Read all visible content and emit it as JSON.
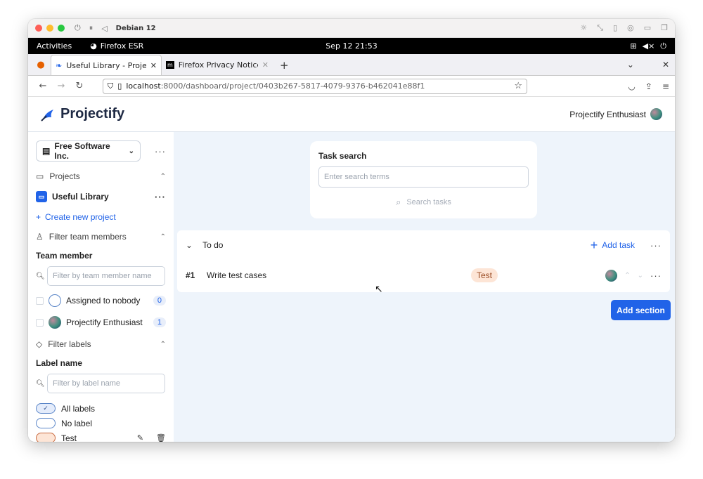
{
  "vm": {
    "title": "Debian 12"
  },
  "gnome": {
    "activities": "Activities",
    "app": "Firefox ESR",
    "clock": "Sep 12  21:53"
  },
  "tabs": [
    {
      "label": "Useful Library - Projectify"
    },
    {
      "label": "Firefox Privacy Notice — "
    }
  ],
  "url": {
    "host": "localhost",
    "path": ":8000/dashboard/project/0403b267-5817-4079-9376-b462041e88f1"
  },
  "app": {
    "name": "Projectify",
    "user": "Projectify Enthusiast"
  },
  "sidebar": {
    "org": "Free Software Inc.",
    "projects_heading": "Projects",
    "project": "Useful Library",
    "create_project": "Create new project",
    "filter_members_heading": "Filter team members",
    "team_member_label": "Team member",
    "member_filter_placeholder": "Filter by team member name",
    "members": [
      {
        "name": "Assigned to nobody",
        "count": "0"
      },
      {
        "name": "Projectify Enthusiast",
        "count": "1"
      }
    ],
    "filter_labels_heading": "Filter labels",
    "label_name_label": "Label name",
    "label_filter_placeholder": "Filter by label name",
    "labels": [
      {
        "name": "All labels",
        "checked": true
      },
      {
        "name": "No label",
        "checked": false
      },
      {
        "name": "Test",
        "checked": false,
        "color": "#fde5d6"
      }
    ]
  },
  "main": {
    "search_title": "Task search",
    "search_placeholder": "Enter search terms",
    "search_button": "Search tasks",
    "section": {
      "title": "To do",
      "add_task": "Add task",
      "tasks": [
        {
          "number": "#1",
          "title": "Write test cases",
          "label": "Test"
        }
      ]
    },
    "add_section": "Add section"
  },
  "colors": {
    "accent": "#2163e8",
    "main_bg": "#eef4fb",
    "test_label": "#fde5d6"
  }
}
